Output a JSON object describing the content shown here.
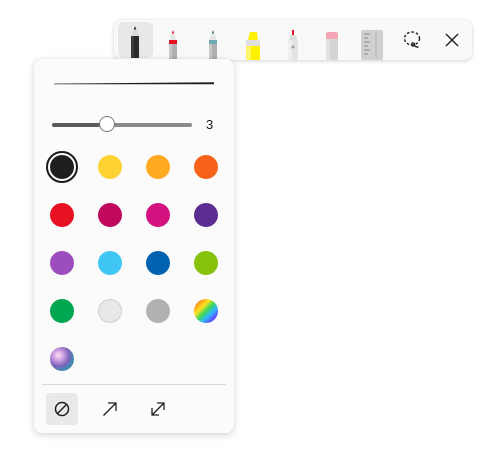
{
  "toolbar": {
    "tools": [
      {
        "name": "ballpoint-pen",
        "selected": true,
        "color": "#1f1f1f"
      },
      {
        "name": "red-pen",
        "color": "#e81123"
      },
      {
        "name": "pencil",
        "color": "#5f8fa0"
      },
      {
        "name": "highlighter",
        "color": "#fff100"
      },
      {
        "name": "eraser-pen",
        "color": "#e6e6e6"
      },
      {
        "name": "eraser",
        "color": "#f4a6b4"
      },
      {
        "name": "ruler",
        "color": "#cccccc"
      },
      {
        "name": "lasso-select-icon"
      },
      {
        "name": "close-icon"
      }
    ]
  },
  "pen_panel": {
    "stroke_size_label": "3",
    "stroke_size": 3,
    "stroke_size_fraction": 0.39,
    "stroke_preview_color": "#1f1f1f",
    "colors": [
      {
        "name": "black",
        "hex": "#1f1f1f",
        "selected": true
      },
      {
        "name": "yellow",
        "hex": "#ffd233"
      },
      {
        "name": "orange",
        "hex": "#ffaa21"
      },
      {
        "name": "dark-orange",
        "hex": "#f7631b"
      },
      {
        "name": "red",
        "hex": "#e81123"
      },
      {
        "name": "crimson",
        "hex": "#c0095c"
      },
      {
        "name": "magenta",
        "hex": "#d3117f"
      },
      {
        "name": "purple",
        "hex": "#5c2e91"
      },
      {
        "name": "violet",
        "hex": "#9c4dbe"
      },
      {
        "name": "light-blue",
        "hex": "#40c6f5"
      },
      {
        "name": "blue",
        "hex": "#0063b1"
      },
      {
        "name": "lime",
        "hex": "#86c20c"
      },
      {
        "name": "green",
        "hex": "#00a650"
      },
      {
        "name": "light-gray",
        "hex": "#e8e8e8"
      },
      {
        "name": "gray",
        "hex": "#b1b1b1"
      },
      {
        "name": "rainbow",
        "hex": "rainbow"
      },
      {
        "name": "galaxy",
        "hex": "galaxy"
      }
    ],
    "tip_options": [
      {
        "name": "no-arrow",
        "selected": true
      },
      {
        "name": "arrow-end"
      },
      {
        "name": "arrow-both"
      }
    ]
  }
}
